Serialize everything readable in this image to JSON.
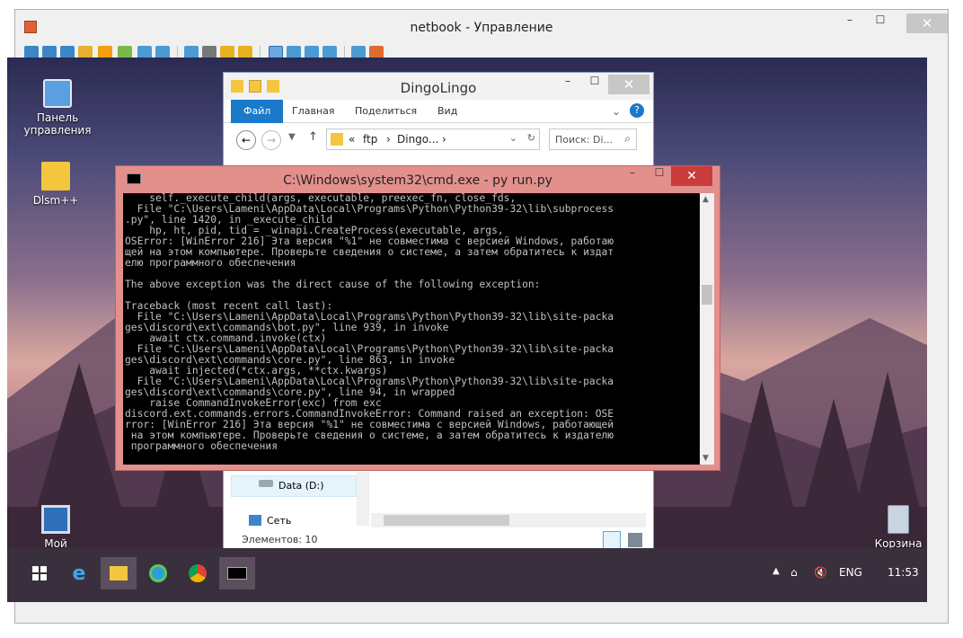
{
  "outer_window": {
    "title": "netbook - Управление",
    "minimize": "–",
    "maximize": "☐",
    "close": "✕"
  },
  "desktop_icons": [
    {
      "label": "Панель управления",
      "icon": "control-panel-icon"
    },
    {
      "label": "Dlsm++",
      "icon": "folder-icon"
    },
    {
      "label": "Мой компьютер",
      "icon": "computer-icon"
    },
    {
      "label": "Корзина",
      "icon": "recycle-bin-icon"
    }
  ],
  "explorer": {
    "title": "DingoLingo",
    "tabs": [
      "Файл",
      "Главная",
      "Поделиться",
      "Вид"
    ],
    "address": [
      "«",
      "ftp",
      "›",
      "Dingo...",
      "›"
    ],
    "search_placeholder": "Поиск: Di...",
    "nav_items": [
      "Data (D:)",
      "Сеть"
    ],
    "status": "Элементов: 10"
  },
  "cmd": {
    "title": "C:\\Windows\\system32\\cmd.exe - py  run.py",
    "lines": "    self._execute_child(args, executable, preexec_fn, close_fds,\n  File \"C:\\Users\\Lameni\\AppData\\Local\\Programs\\Python\\Python39-32\\lib\\subprocess\n.py\", line 1420, in _execute_child\n    hp, ht, pid, tid = _winapi.CreateProcess(executable, args,\nOSError: [WinError 216] Эта версия \"%1\" не совместима с версией Windows, работаю\nщей на этом компьютере. Проверьте сведения о системе, а затем обратитесь к издат\nелю программного обеспечения\n\nThe above exception was the direct cause of the following exception:\n\nTraceback (most recent call last):\n  File \"C:\\Users\\Lameni\\AppData\\Local\\Programs\\Python\\Python39-32\\lib\\site-packa\nges\\discord\\ext\\commands\\bot.py\", line 939, in invoke\n    await ctx.command.invoke(ctx)\n  File \"C:\\Users\\Lameni\\AppData\\Local\\Programs\\Python\\Python39-32\\lib\\site-packa\nges\\discord\\ext\\commands\\core.py\", line 863, in invoke\n    await injected(*ctx.args, **ctx.kwargs)\n  File \"C:\\Users\\Lameni\\AppData\\Local\\Programs\\Python\\Python39-32\\lib\\site-packa\nges\\discord\\ext\\commands\\core.py\", line 94, in wrapped\n    raise CommandInvokeError(exc) from exc\ndiscord.ext.commands.errors.CommandInvokeError: Command raised an exception: OSE\nrror: [WinError 216] Эта версия \"%1\" не совместима с версией Windows, работающей\n на этом компьютере. Проверьте сведения о системе, а затем обратитесь к издателю\n программного обеспечения"
  },
  "taskbar": {
    "items": [
      "start-icon",
      "ie-icon",
      "explorer-icon",
      "edge-icon",
      "chrome-icon",
      "cmd-icon"
    ],
    "tray_up": "▲",
    "lang": "ENG",
    "time": "11:53"
  }
}
